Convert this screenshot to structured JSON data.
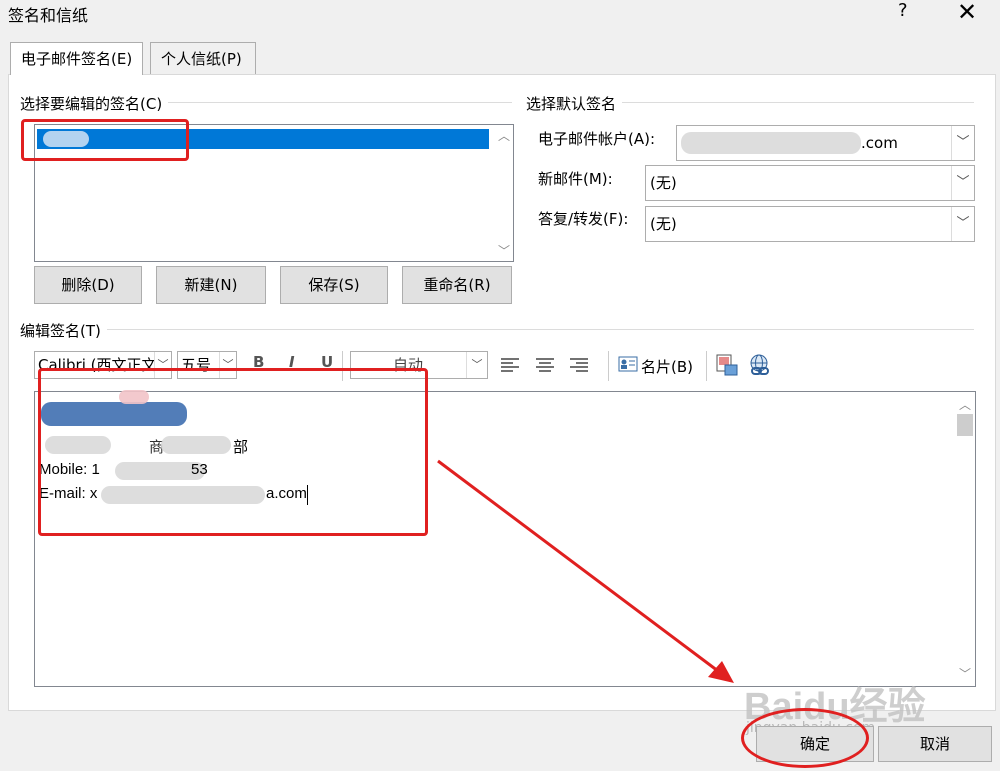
{
  "dialog": {
    "title": "签名和信纸",
    "help_label": "?",
    "close_label": "✕"
  },
  "tabs": [
    {
      "label": "电子邮件签名(E)"
    },
    {
      "label": "个人信纸(P)"
    }
  ],
  "select_signature": {
    "heading": "选择要编辑的签名(C)",
    "buttons": {
      "delete": "删除(D)",
      "new": "新建(N)",
      "save": "保存(S)",
      "rename": "重命名(R)"
    }
  },
  "default_signature": {
    "heading": "选择默认签名",
    "account_label": "电子邮件帐户(A):",
    "account_value_suffix": ".com",
    "new_mail_label": "新邮件(M):",
    "new_mail_value": "(无)",
    "reply_label": "答复/转发(F):",
    "reply_value": "(无)"
  },
  "edit_signature": {
    "heading": "编辑签名(T)",
    "font_name": "Calibri (西文正文",
    "font_size": "五号",
    "bold": "B",
    "italic": "I",
    "underline": "U",
    "color_value": "自动",
    "business_card": "名片(B)"
  },
  "signature_text": {
    "dept_suffix": "部",
    "mobile_prefix": "Mobile: 1",
    "mobile_suffix": "53",
    "email_prefix": "E-mail: x",
    "email_suffix": "a.com"
  },
  "footer": {
    "ok": "确定",
    "cancel": "取消"
  },
  "watermark": {
    "text": "Baidu经验",
    "subtext": "jingyan.baidu.com"
  },
  "colors": {
    "selection": "#0078d7",
    "annotation_red": "#e02020"
  }
}
